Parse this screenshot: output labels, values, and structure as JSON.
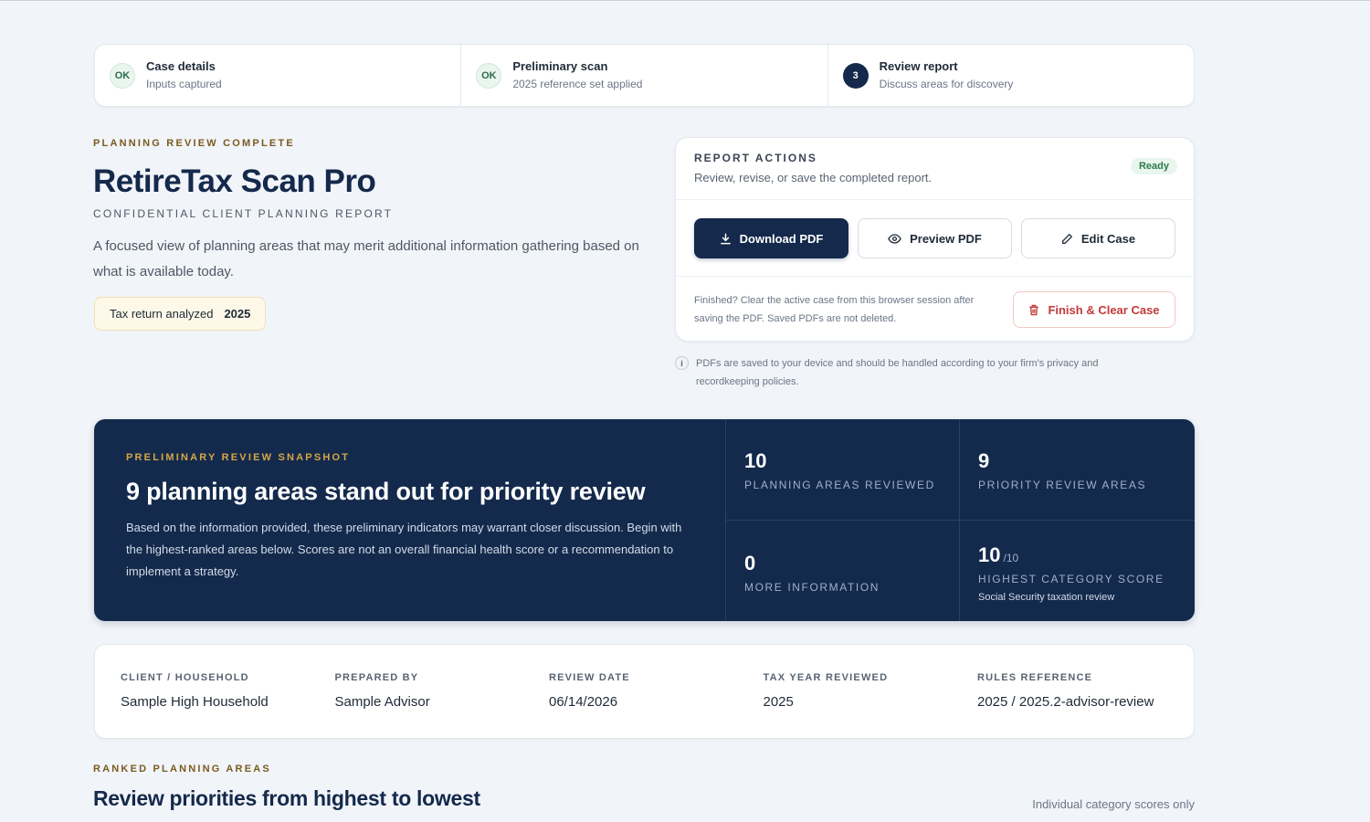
{
  "stepper": [
    {
      "badge": "OK",
      "title": "Case details",
      "subtitle": "Inputs captured"
    },
    {
      "badge": "OK",
      "title": "Preliminary scan",
      "subtitle": "2025 reference set applied"
    },
    {
      "badge": "3",
      "title": "Review report",
      "subtitle": "Discuss areas for discovery"
    }
  ],
  "hero": {
    "eyebrow": "PLANNING REVIEW COMPLETE",
    "title": "RetireTax Scan Pro",
    "subtitle": "CONFIDENTIAL CLIENT PLANNING REPORT",
    "description": "A focused view of planning areas that may merit additional information gathering based on what is available today.",
    "tax_pill_label": "Tax return analyzed",
    "tax_pill_year": "2025"
  },
  "report_actions": {
    "label": "REPORT ACTIONS",
    "description": "Review, revise, or save the completed report.",
    "status": "Ready",
    "download_label": "Download PDF",
    "preview_label": "Preview PDF",
    "edit_label": "Edit Case",
    "footer_text": "Finished? Clear the active case from this browser session after saving the PDF. Saved PDFs are not deleted.",
    "finish_label": "Finish & Clear Case",
    "note": "PDFs are saved to your device and should be handled according to your firm's privacy and recordkeeping policies."
  },
  "snapshot": {
    "eyebrow": "PRELIMINARY REVIEW SNAPSHOT",
    "title": "9 planning areas stand out for priority review",
    "description": "Based on the information provided, these preliminary indicators may warrant closer discussion. Begin with the highest-ranked areas below. Scores are not an overall financial health score or a recommendation to implement a strategy.",
    "stats": [
      {
        "value": "10",
        "label": "PLANNING AREAS REVIEWED"
      },
      {
        "value": "9",
        "label": "PRIORITY REVIEW AREAS"
      },
      {
        "value": "0",
        "label": "MORE INFORMATION"
      },
      {
        "value": "10",
        "denominator": "/10",
        "label": "HIGHEST CATEGORY SCORE",
        "sub": "Social Security taxation review"
      }
    ]
  },
  "meta": [
    {
      "label": "CLIENT / HOUSEHOLD",
      "value": "Sample High Household"
    },
    {
      "label": "PREPARED BY",
      "value": "Sample Advisor"
    },
    {
      "label": "REVIEW DATE",
      "value": "06/14/2026"
    },
    {
      "label": "TAX YEAR REVIEWED",
      "value": "2025"
    },
    {
      "label": "RULES REFERENCE",
      "value": "2025 / 2025.2-advisor-review"
    }
  ],
  "ranked": {
    "eyebrow": "RANKED PLANNING AREAS",
    "title": "Review priorities from highest to lowest",
    "note": "Individual category scores only"
  },
  "icons": {
    "download": "download-icon",
    "preview": "eye-icon",
    "edit": "pencil-icon",
    "finish": "trash-icon",
    "info": "info-icon"
  },
  "colors": {
    "navy": "#14294b",
    "snapshot_bg": "#132a4d",
    "gold": "#d6a744",
    "eyebrow_brown": "#7a5a1f",
    "ready_green": "#2d7a4a",
    "danger_red": "#c23a3a"
  }
}
